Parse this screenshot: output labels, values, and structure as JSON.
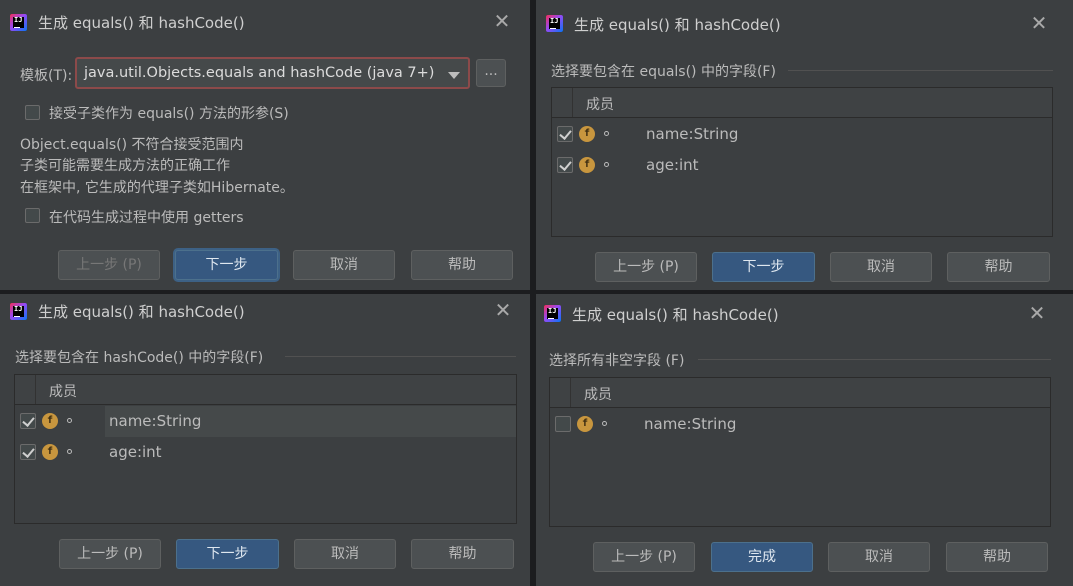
{
  "title": "生成 equals() 和 hashCode()",
  "close_glyph": "✕",
  "app_icon_text": "IJ",
  "buttons": {
    "prev": "上一步 (P)",
    "next": "下一步",
    "cancel": "取消",
    "help": "帮助",
    "finish": "完成"
  },
  "step1": {
    "template_label": "模板(T):",
    "template_value": "java.util.Objects.equals and hashCode (java 7+)",
    "ellipsis": "...",
    "accept_subclasses_label": "接受子类作为 equals() 方法的形参(S)",
    "accept_subclasses_checked": false,
    "info_lines": [
      "Object.equals() 不符合接受范围内",
      "子类可能需要生成方法的正确工作",
      "在框架中, 它生成的代理子类如Hibernate。"
    ],
    "use_getters_label": "在代码生成过程中使用 getters",
    "use_getters_checked": false
  },
  "step2": {
    "section": "选择要包含在 equals() 中的字段(F)",
    "column": "成员",
    "fields": [
      {
        "name": "name:String",
        "checked": true
      },
      {
        "name": "age:int",
        "checked": true
      }
    ]
  },
  "step3": {
    "section": "选择要包含在 hashCode() 中的字段(F)",
    "column": "成员",
    "fields": [
      {
        "name": "name:String",
        "checked": true
      },
      {
        "name": "age:int",
        "checked": true
      }
    ]
  },
  "step4": {
    "section": "选择所有非空字段 (F)",
    "column": "成员",
    "fields": [
      {
        "name": "name:String",
        "checked": false
      }
    ]
  },
  "field_icon_letter": "f"
}
